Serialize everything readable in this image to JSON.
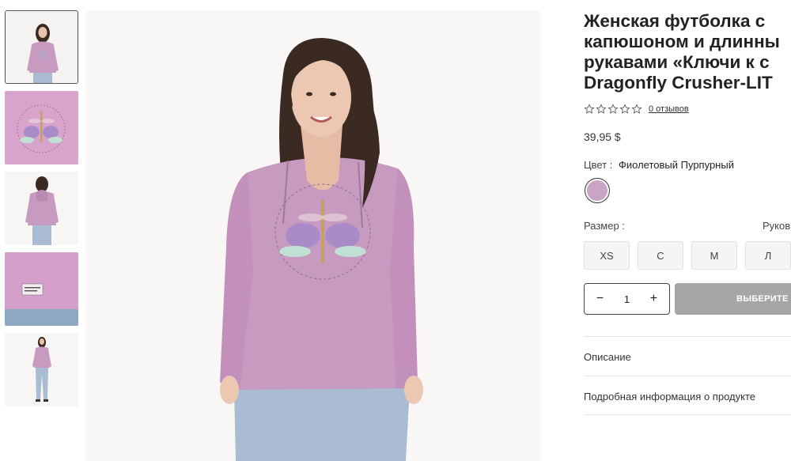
{
  "thumbnails": [
    {
      "name": "model-front"
    },
    {
      "name": "graphic-closeup"
    },
    {
      "name": "model-back"
    },
    {
      "name": "label-closeup"
    },
    {
      "name": "model-full"
    }
  ],
  "product": {
    "title_line1": "Женская футболка с",
    "title_line2": "капюшоном и длинны",
    "title_line3": "рукавами «Ключи к с",
    "title_line4": "Dragonfly Crusher-LIT",
    "reviews_link": "0 отзывов",
    "rating": 0,
    "price": "39,95 $",
    "color_label": "Цвет :",
    "color_value": "Фиолетовый Пурпурный",
    "swatch_color": "#c9a4c4",
    "size_label": "Размер :",
    "size_guide": "Руков",
    "sizes": [
      "XS",
      "С",
      "М",
      "Л"
    ],
    "quantity": "1",
    "qty_minus": "−",
    "qty_plus": "+",
    "add_button": "ВЫБЕРИТЕ",
    "accordion_description": "Описание",
    "accordion_details": "Подробная информация о продукте"
  },
  "colors": {
    "shirt": "#c79ac0",
    "jeans": "#a9bcd1",
    "hair": "#3a2a22",
    "button_disabled": "#a6a6a6"
  }
}
